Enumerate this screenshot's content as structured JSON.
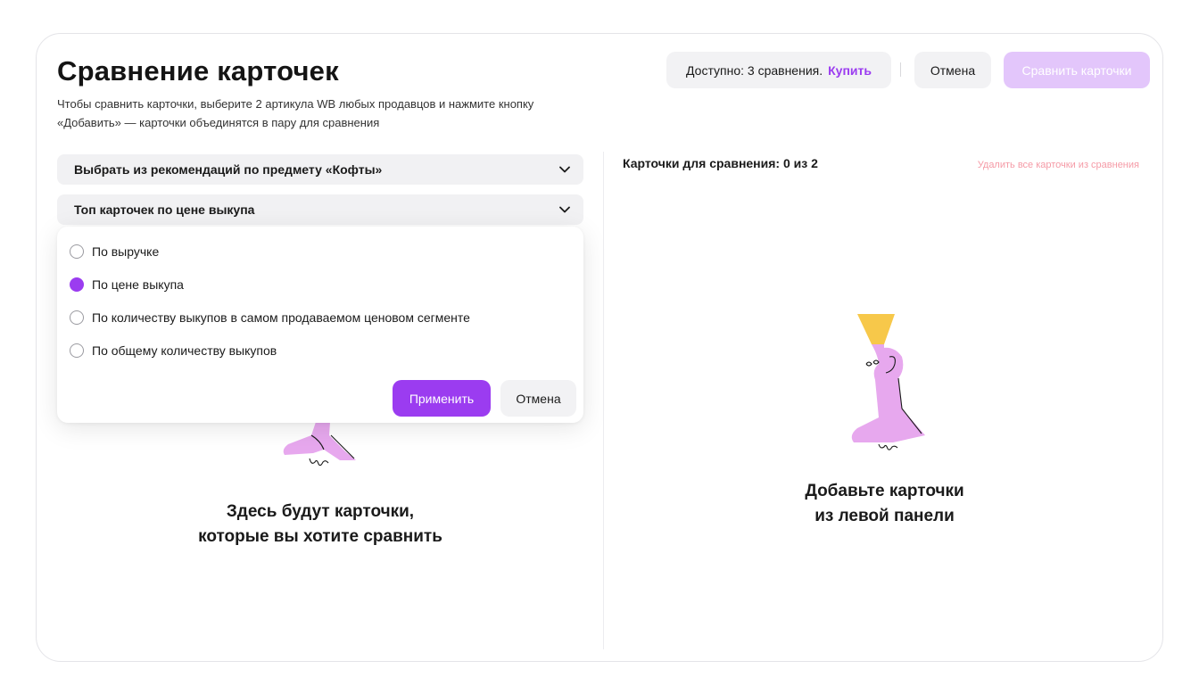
{
  "header": {
    "title": "Сравнение карточек",
    "subtitle_line1": "Чтобы сравнить карточки, выберите 2 артикула WB любых продавцов и нажмите кнопку",
    "subtitle_line2": "«Добавить» — карточки объединятся в пару для сравнения"
  },
  "toolbar": {
    "available_text": "Доступно: 3 сравнения.",
    "buy_label": "Купить",
    "cancel_label": "Отмена",
    "compare_label": "Сравнить карточки"
  },
  "left": {
    "dropdown1": {
      "label": "Выбрать из рекомендаций по предмету «Кофты»",
      "icon": "chevron-down-icon"
    },
    "dropdown2": {
      "label": "Топ карточек по цене выкупа",
      "icon": "chevron-down-icon"
    },
    "popup": {
      "options": [
        {
          "label": "По выручке",
          "selected": false
        },
        {
          "label": "По цене выкупа",
          "selected": true
        },
        {
          "label": "По количеству выкупов в самом продаваемом ценовом сегменте",
          "selected": false
        },
        {
          "label": "По общему количеству выкупов",
          "selected": false
        }
      ],
      "apply_label": "Применить",
      "cancel_label": "Отмена"
    },
    "empty_line1": "Здесь будут карточки,",
    "empty_line2": "которые вы хотите сравнить"
  },
  "right": {
    "header": "Карточки для сравнения: 0 из 2",
    "remove_all": "Удалить все карточки из сравнения",
    "empty_line1": "Добавьте карточки",
    "empty_line2": "из левой панели"
  },
  "colors": {
    "accent": "#9b3cf0",
    "accent_disabled": "#e3c6fb",
    "danger_link": "#f59aa6",
    "illustration_figure": "#e7a8ee",
    "illustration_lamp": "#f7c84a"
  }
}
